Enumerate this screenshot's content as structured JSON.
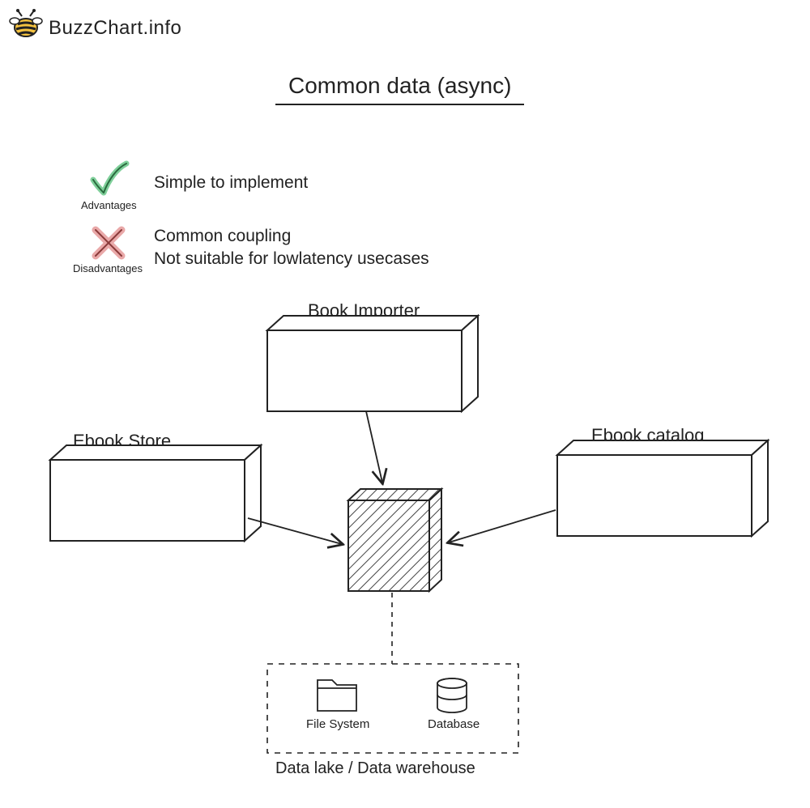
{
  "brand": {
    "name": "BuzzChart.info"
  },
  "title": "Common data (async)",
  "advantages": {
    "label": "Advantages",
    "items": [
      "Simple to implement"
    ]
  },
  "disadvantages": {
    "label": "Disadvantages",
    "items": [
      "Common coupling",
      "Not suitable for lowlatency usecases"
    ]
  },
  "nodes": {
    "book_importer": "Book Importer",
    "ebook_store": "Ebook Store",
    "ebook_catalog": "Ebook catalog"
  },
  "storage": {
    "file_system": "File System",
    "database": "Database",
    "group_label": "Data lake / Data warehouse"
  }
}
